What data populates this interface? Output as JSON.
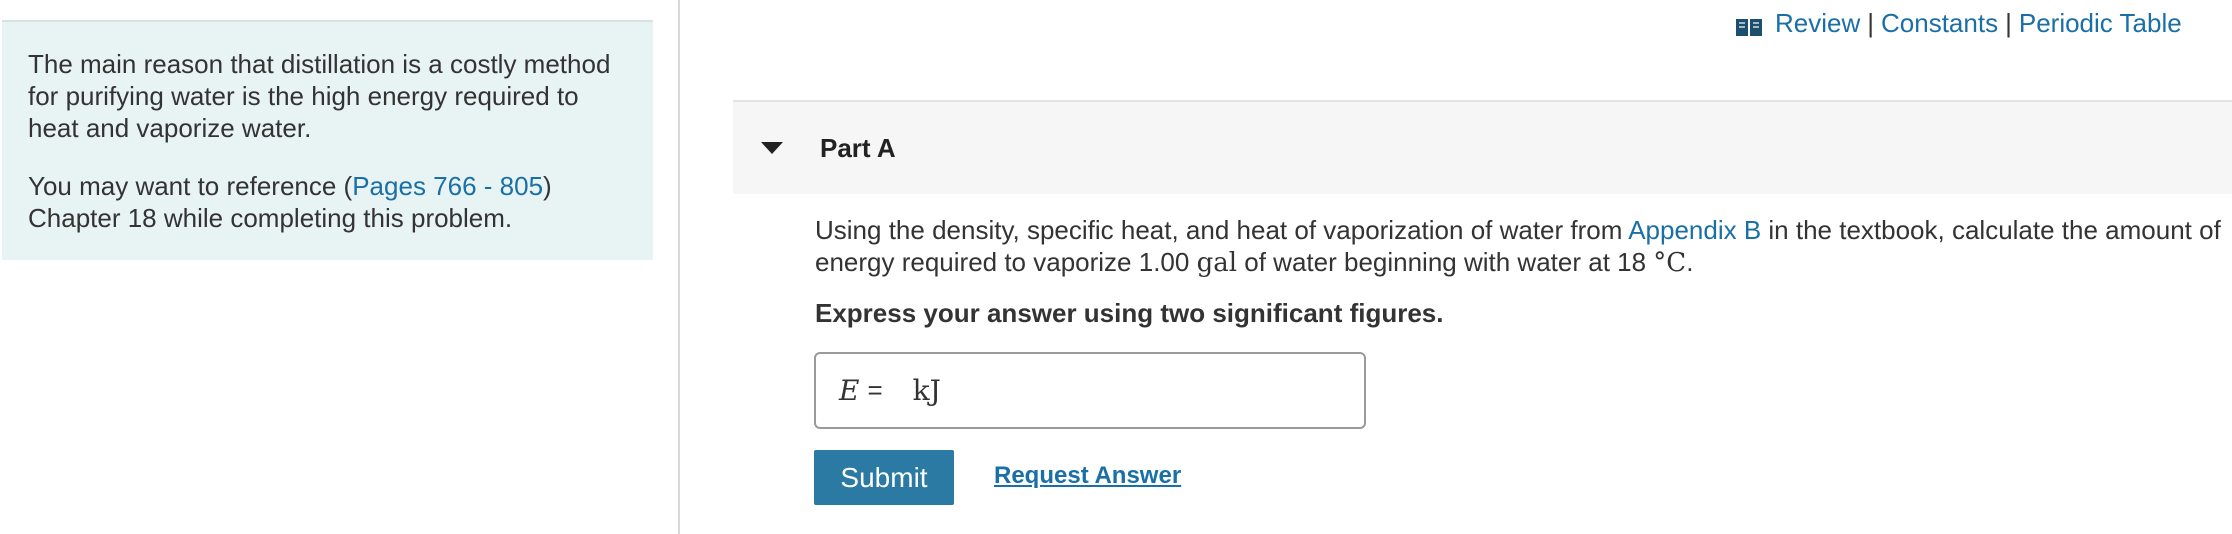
{
  "info_panel": {
    "paragraph1": "The main reason that distillation is a costly method for purifying water is the high energy required to heat and vaporize water.",
    "paragraph2_prefix": "You may want to reference (",
    "paragraph2_link": "Pages 766 - 805",
    "paragraph2_suffix": ")",
    "paragraph2_line2": "Chapter 18 while completing this problem."
  },
  "resources": {
    "icon": "book-icon",
    "review": "Review",
    "constants": "Constants",
    "periodic_table": "Periodic Table",
    "separator": "|"
  },
  "part": {
    "title": "Part A",
    "caret_icon": "caret-down-icon"
  },
  "question": {
    "text_before_link": "Using the density, specific heat, and heat of vaporization of water from ",
    "link": "Appendix B",
    "text_after_link": " in the textbook, calculate the amount of energy required to vaporize 1.00 ",
    "unit_gal": "gal",
    "text_mid": " of water beginning with water at 18 ",
    "unit_temp": "°C",
    "text_end": ".",
    "instruction": "Express your answer using two significant figures."
  },
  "answer": {
    "variable": "E",
    "equals": "=",
    "value": "",
    "unit": "kJ"
  },
  "actions": {
    "submit": "Submit",
    "request_answer": "Request Answer"
  },
  "colors": {
    "accent": "#2a7aa3",
    "link": "#1a6fa6",
    "panel_bg": "#e8f4f4"
  }
}
